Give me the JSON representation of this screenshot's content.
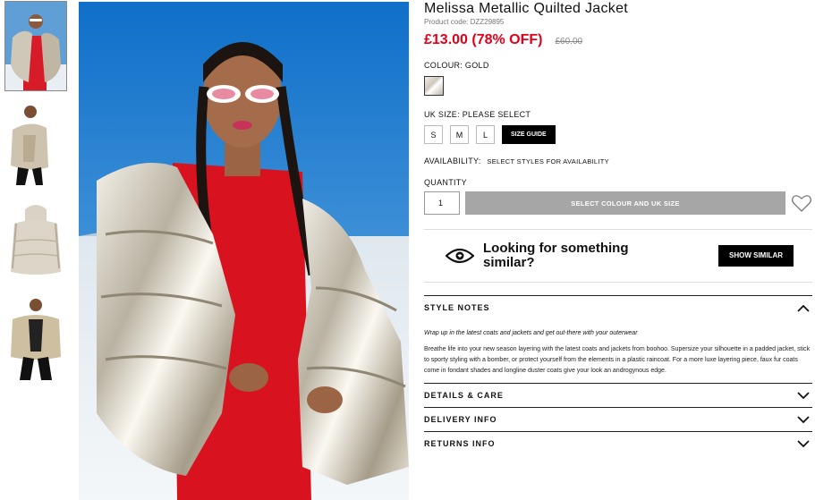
{
  "product": {
    "title": "Melissa Metallic Quilted Jacket",
    "code": "Product code: DZZ29895",
    "price_now": "£13.00 (78% OFF)",
    "price_was": "£60.00"
  },
  "colour": {
    "label": "COLOUR:",
    "value": "GOLD"
  },
  "size": {
    "label": "UK SIZE:",
    "value": "PLEASE SELECT",
    "options": [
      "S",
      "M",
      "L"
    ],
    "guide": "SIZE GUIDE"
  },
  "availability": {
    "label": "AVAILABILITY:",
    "value": "SELECT STYLES FOR AVAILABILITY"
  },
  "quantity": {
    "label": "QUANTITY",
    "value": "1"
  },
  "add_button": "SELECT COLOUR AND UK SIZE",
  "similar": {
    "text": "Looking for something similar?",
    "button": "SHOW SIMILAR"
  },
  "accordion": {
    "style_notes": {
      "title": "STYLE NOTES",
      "intro": "Wrap up in the latest coats and jackets and get out-there with your outerwear",
      "body": "Breathe life into your new season layering with the latest coats and jackets from boohoo. Supersize your silhouette in a padded jacket, stick to sporty styling with a bomber, or protect yourself from the elements in a plastic raincoat. For a more luxe layering piece, faux fur coats come in fondant shades and longline duster coats give your look an androgynous edge."
    },
    "details": "DETAILS & CARE",
    "delivery": "DELIVERY INFO",
    "returns": "RETURNS INFO"
  },
  "colors": {
    "price_red": "#e1001a",
    "button_grey": "#a6a6a6",
    "black": "#000000"
  }
}
